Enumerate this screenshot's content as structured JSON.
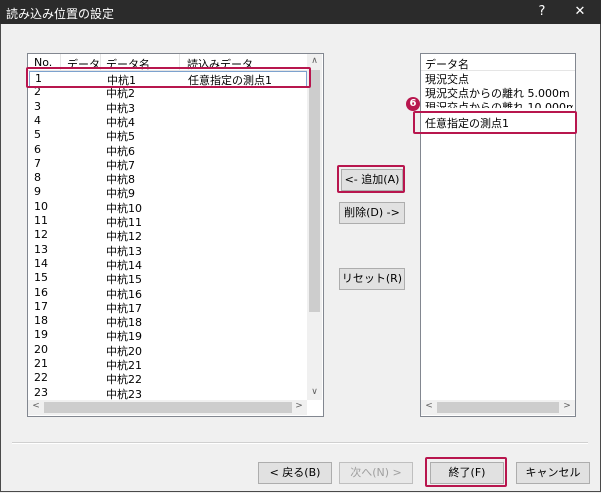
{
  "window": {
    "title": "読み込み位置の設定",
    "help": "?",
    "close": "✕"
  },
  "left_list": {
    "columns": [
      "No.",
      "データ",
      "データ名",
      "読込みデータ"
    ],
    "rows": [
      {
        "no": "1",
        "name": "中杭1",
        "read": "任意指定の測点1"
      },
      {
        "no": "2",
        "name": "中杭2",
        "read": ""
      },
      {
        "no": "3",
        "name": "中杭3",
        "read": ""
      },
      {
        "no": "4",
        "name": "中杭4",
        "read": ""
      },
      {
        "no": "5",
        "name": "中杭5",
        "read": ""
      },
      {
        "no": "6",
        "name": "中杭6",
        "read": ""
      },
      {
        "no": "7",
        "name": "中杭7",
        "read": ""
      },
      {
        "no": "8",
        "name": "中杭8",
        "read": ""
      },
      {
        "no": "9",
        "name": "中杭9",
        "read": ""
      },
      {
        "no": "10",
        "name": "中杭10",
        "read": ""
      },
      {
        "no": "11",
        "name": "中杭11",
        "read": ""
      },
      {
        "no": "12",
        "name": "中杭12",
        "read": ""
      },
      {
        "no": "13",
        "name": "中杭13",
        "read": ""
      },
      {
        "no": "14",
        "name": "中杭14",
        "read": ""
      },
      {
        "no": "15",
        "name": "中杭15",
        "read": ""
      },
      {
        "no": "16",
        "name": "中杭16",
        "read": ""
      },
      {
        "no": "17",
        "name": "中杭17",
        "read": ""
      },
      {
        "no": "18",
        "name": "中杭18",
        "read": ""
      },
      {
        "no": "19",
        "name": "中杭19",
        "read": ""
      },
      {
        "no": "20",
        "name": "中杭20",
        "read": ""
      },
      {
        "no": "21",
        "name": "中杭21",
        "read": ""
      },
      {
        "no": "22",
        "name": "中杭22",
        "read": ""
      },
      {
        "no": "23",
        "name": "中杭23",
        "read": ""
      }
    ]
  },
  "right_list": {
    "column": "データ名",
    "items": [
      "現況交点",
      "現況交点からの離れ 5.000m",
      "現況交点からの離れ 10.000m",
      "任意指定の測点1"
    ],
    "badge": "6"
  },
  "buttons": {
    "add": "<- 追加(A)",
    "delete": "削除(D) ->",
    "reset": "リセット(R)",
    "back": "< 戻る(B)",
    "next": "次へ(N) >",
    "finish": "終了(F)",
    "cancel": "キャンセル"
  },
  "scroll": {
    "up": "∧",
    "down": "∨",
    "left": "<",
    "right": ">"
  }
}
